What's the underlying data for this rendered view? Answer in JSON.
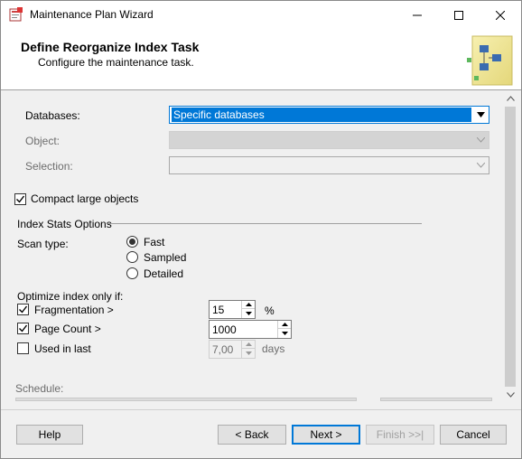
{
  "window": {
    "title": "Maintenance Plan Wizard",
    "icon": "wizard-app-icon"
  },
  "header": {
    "title": "Define Reorganize Index Task",
    "subtitle": "Configure the maintenance task."
  },
  "form": {
    "databases_label": "Databases:",
    "databases_value": "Specific databases",
    "object_label": "Object:",
    "selection_label": "Selection:",
    "compact_label": "Compact large objects",
    "compact_checked": true,
    "index_stats_label": "Index Stats Options",
    "scan_type_label": "Scan type:",
    "scan_options": [
      "Fast",
      "Sampled",
      "Detailed"
    ],
    "scan_selected": "Fast",
    "optimize_label": "Optimize index only if:",
    "fragmentation_label": "Fragmentation >",
    "fragmentation_checked": true,
    "fragmentation_value": "15",
    "fragmentation_unit": "%",
    "page_count_label": "Page Count >",
    "page_count_checked": true,
    "page_count_value": "1000",
    "used_label": "Used  in last",
    "used_checked": false,
    "used_value": "7,00",
    "used_unit": "days",
    "schedule_label": "Schedule:"
  },
  "footer": {
    "help": "Help",
    "back": "< Back",
    "next": "Next >",
    "finish": "Finish >>|",
    "cancel": "Cancel"
  },
  "colors": {
    "accent": "#0078d7",
    "disabled_text": "#6d6d6d"
  }
}
